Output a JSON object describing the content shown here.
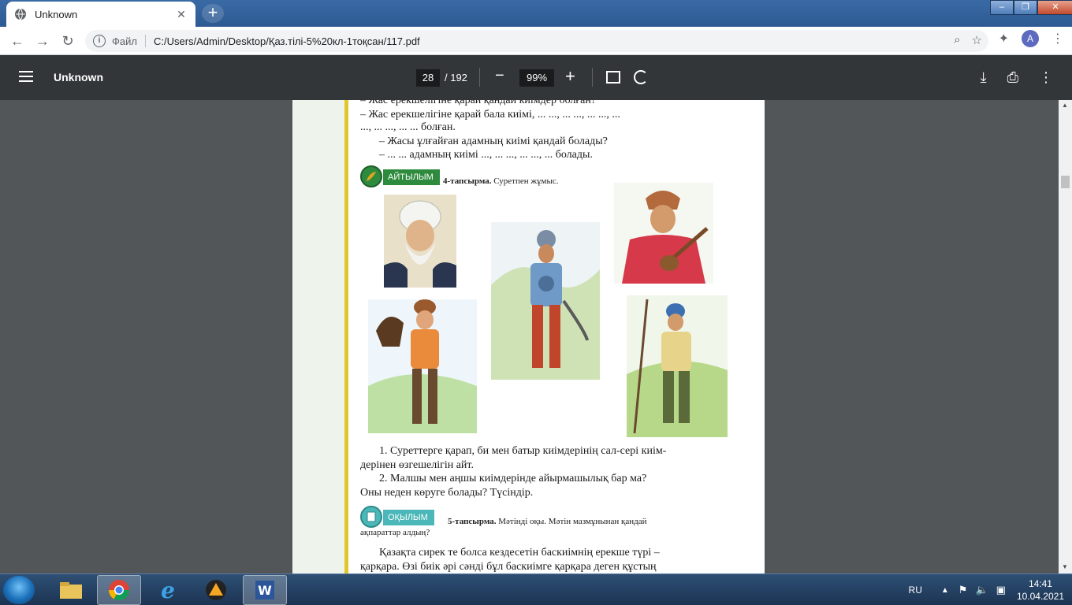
{
  "browser": {
    "tab_title": "Unknown",
    "new_tab_symbol": "+",
    "close_symbol": "✕",
    "scheme_label": "Файл",
    "url": "C:/Users/Admin/Desktop/Қаз.тілі-5%20кл-1тоқсан/117.pdf",
    "profile_initial": "A"
  },
  "pdf": {
    "title": "Unknown",
    "current_page": "28",
    "total_pages": "/ 192",
    "zoom": "99%"
  },
  "page": {
    "lines_top": [
      "– Жас ерекшелігіне қарай қандай киімдер болған?",
      "– Жас ерекшелігіне қарай бала киімі, ... ..., ... ..., ... ..., ...",
      "..., ... ..., ... ... болған.",
      "– Жасы ұлғайған адамның киімі қандай болады?",
      "–  ... ... адамның киімі ..., ... ..., ... ..., ... болады."
    ],
    "badge1": "АЙТЫЛЫМ",
    "task4_num": "4-тапсырма.",
    "task4_text": "Суретпен жұмыс.",
    "q1_line1": "1. Суреттерге қарап, би мен батыр киімдерінің сал-сері киім-",
    "q1_line2": "дерінен өзгешелігін айт.",
    "q2_line1": "2. Малшы мен аңшы киімдерінде айырмашылық бар ма?",
    "q2_line2": "Оны неден көруге болады? Түсіндір.",
    "badge2": "ОҚЫЛЫМ",
    "task5_num": "5-тапсырма.",
    "task5_text1": "Мәтінді оқы. Мәтін мазмұнынан қандай",
    "task5_text2": "ақпараттар алдың?",
    "para_line1": "Қазақта сирек те болса кездесетін баскиімнің ерекше түрі –",
    "para_line2": "қарқара. Өзі биік әрі  сәнді бұл баскиімге қарқара деген құстың"
  },
  "taskbar": {
    "lang": "RU",
    "time": "14:41",
    "date": "10.04.2021"
  },
  "colors": {
    "chrome_accent": "#2d5a92",
    "pdf_toolbar": "#323639",
    "badge_green": "#2e8b3e",
    "badge_teal": "#4bb7b8",
    "margin_yellow": "#e3c72a"
  }
}
